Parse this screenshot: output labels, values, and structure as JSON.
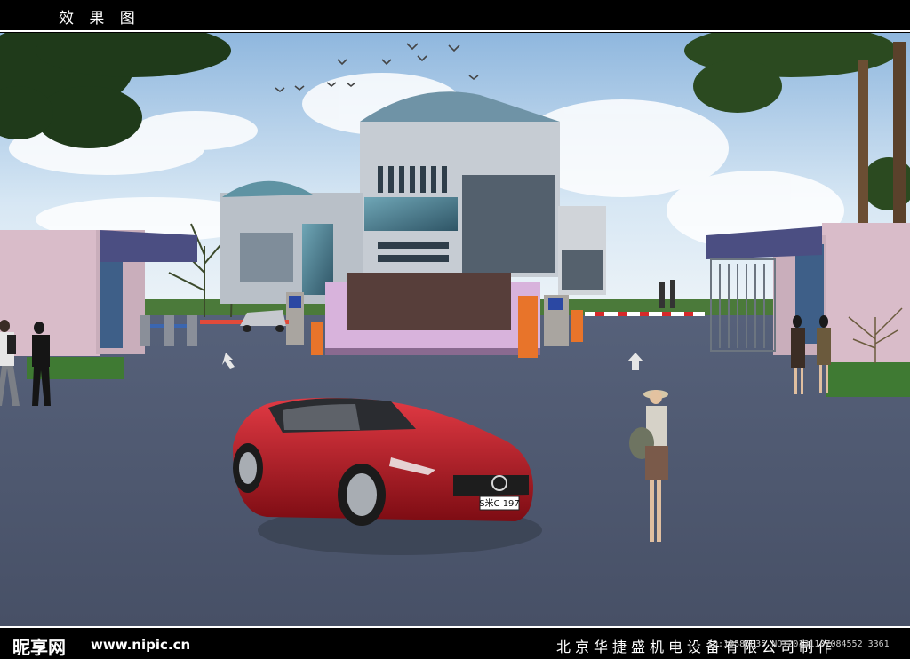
{
  "header": {
    "title": "效 果 图"
  },
  "scene": {
    "plate": "S米C 197"
  },
  "footer": {
    "logo": "昵享网",
    "url": "www.nipic.cn",
    "credit": "北京华捷盛机电设备有限公司制作",
    "image_id": "ID:10585035 NO:20131107084552 3361"
  },
  "colors": {
    "sky_top": "#9fc4e6",
    "road": "#4b5565",
    "car": "#b5141f",
    "wall": "#d7b9c7",
    "barrier": "#e8742a"
  }
}
